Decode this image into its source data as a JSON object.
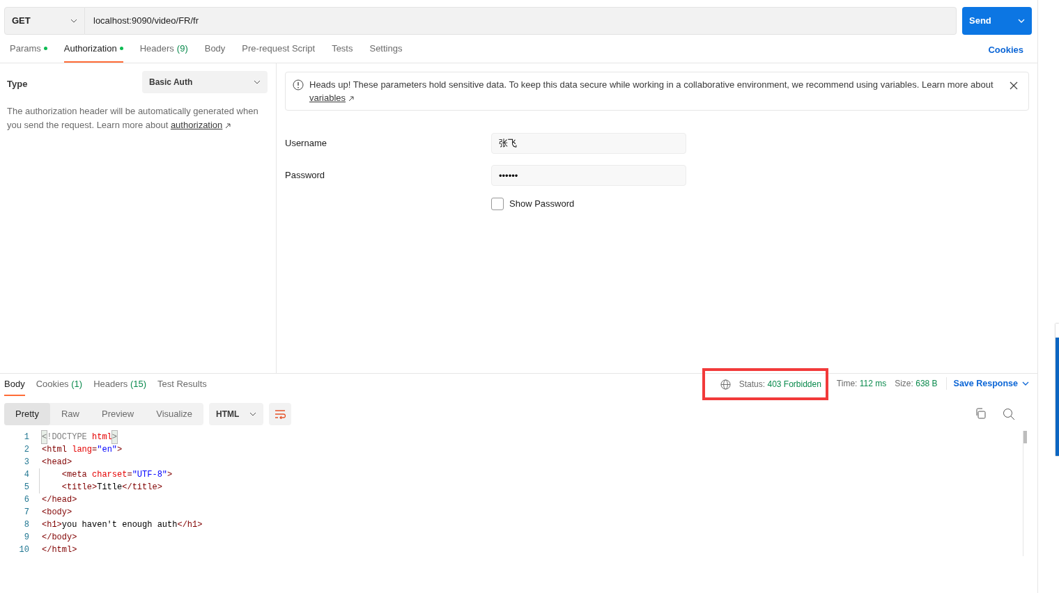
{
  "request": {
    "method": "GET",
    "url": "localhost:9090/video/FR/fr",
    "send_label": "Send"
  },
  "request_tabs": [
    {
      "label": "Params",
      "dot": true,
      "selected": false
    },
    {
      "label": "Authorization",
      "dot": true,
      "selected": true
    },
    {
      "label": "Headers",
      "count": "(9)",
      "dot": false,
      "selected": false
    },
    {
      "label": "Body",
      "dot": false,
      "selected": false
    },
    {
      "label": "Pre-request Script",
      "dot": false,
      "selected": false
    },
    {
      "label": "Tests",
      "dot": false,
      "selected": false
    },
    {
      "label": "Settings",
      "dot": false,
      "selected": false
    }
  ],
  "cookies_link": "Cookies",
  "auth": {
    "type_label": "Type",
    "type_value": "Basic Auth",
    "description": "The authorization header will be automatically generated when you send the request. Learn more about",
    "description_link": "authorization",
    "alert": {
      "text": "Heads up! These parameters hold sensitive data. To keep this data secure while working in a collaborative environment, we recommend using variables. Learn more about",
      "link": "variables"
    },
    "username_label": "Username",
    "username": "张飞",
    "password_label": "Password",
    "password": "••••••",
    "show_password": {
      "label": "Show Password",
      "checked": false
    }
  },
  "response_tabs": [
    {
      "label": "Body",
      "selected": true
    },
    {
      "label": "Cookies",
      "count": "(1)",
      "selected": false
    },
    {
      "label": "Headers",
      "count": "(15)",
      "selected": false
    },
    {
      "label": "Test Results",
      "selected": false
    }
  ],
  "status": {
    "highlighted": true,
    "status_label": "Status:",
    "status_value": "403 Forbidden",
    "time_label": "Time:",
    "time_value": "112 ms",
    "size_label": "Size:",
    "size_value": "638 B",
    "save_label": "Save Response"
  },
  "view_modes": [
    {
      "label": "Pretty",
      "selected": true
    },
    {
      "label": "Raw",
      "selected": false
    },
    {
      "label": "Preview",
      "selected": false
    },
    {
      "label": "Visualize",
      "selected": false
    }
  ],
  "format": "HTML",
  "code_lines": [
    {
      "number": "1",
      "guide": false,
      "tokens": [
        {
          "t": "<",
          "kind": "match"
        },
        {
          "t": "!DOCTYPE ",
          "kind": "doctype"
        },
        {
          "t": "html",
          "kind": "attr"
        },
        {
          "t": ">",
          "kind": "match"
        }
      ]
    },
    {
      "number": "2",
      "guide": false,
      "tokens": [
        {
          "t": "<html ",
          "kind": "tag"
        },
        {
          "t": "lang",
          "kind": "attr"
        },
        {
          "t": "=",
          "kind": "tag"
        },
        {
          "t": "\"en\"",
          "kind": "value"
        },
        {
          "t": ">",
          "kind": "tag"
        }
      ]
    },
    {
      "number": "3",
      "guide": false,
      "tokens": [
        {
          "t": "<head>",
          "kind": "tag"
        }
      ]
    },
    {
      "number": "4",
      "guide": true,
      "tokens": [
        {
          "t": "    <meta ",
          "kind": "tag"
        },
        {
          "t": "charset",
          "kind": "attr"
        },
        {
          "t": "=",
          "kind": "tag"
        },
        {
          "t": "\"UTF-8\"",
          "kind": "value"
        },
        {
          "t": ">",
          "kind": "tag"
        }
      ]
    },
    {
      "number": "5",
      "guide": true,
      "tokens": [
        {
          "t": "    <title>",
          "kind": "tag"
        },
        {
          "t": "Title",
          "kind": "text"
        },
        {
          "t": "</title>",
          "kind": "tag"
        }
      ]
    },
    {
      "number": "6",
      "guide": false,
      "tokens": [
        {
          "t": "</head>",
          "kind": "tag"
        }
      ]
    },
    {
      "number": "7",
      "guide": false,
      "tokens": [
        {
          "t": "<body>",
          "kind": "tag"
        }
      ]
    },
    {
      "number": "8",
      "guide": false,
      "tokens": [
        {
          "t": "<h1>",
          "kind": "tag"
        },
        {
          "t": "you haven't enough auth",
          "kind": "text"
        },
        {
          "t": "</h1>",
          "kind": "tag"
        }
      ]
    },
    {
      "number": "9",
      "guide": false,
      "tokens": [
        {
          "t": "</body>",
          "kind": "tag"
        }
      ]
    },
    {
      "number": "10",
      "guide": false,
      "tokens": [
        {
          "t": "</html>",
          "kind": "tag"
        }
      ]
    }
  ]
}
